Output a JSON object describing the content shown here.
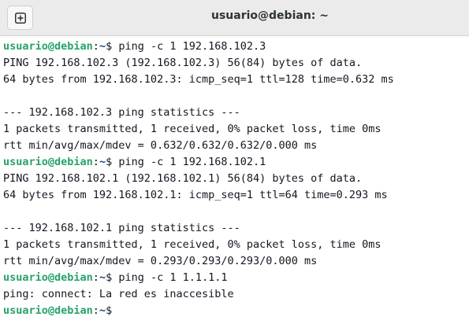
{
  "window": {
    "title": "usuario@debian: ~"
  },
  "icons": {
    "new_tab": "plus-square-icon"
  },
  "colors": {
    "prompt_user": "#26a269",
    "prompt_path": "#12488b",
    "text": "#171421",
    "titlebar": "#ebebeb"
  },
  "terminal": {
    "prompt_user_host": "usuario@debian",
    "prompt_path": "~",
    "lines": [
      {
        "kind": "cmd",
        "command": "ping -c 1 192.168.102.3"
      },
      {
        "kind": "out",
        "text": "PING 192.168.102.3 (192.168.102.3) 56(84) bytes of data."
      },
      {
        "kind": "out",
        "text": "64 bytes from 192.168.102.3: icmp_seq=1 ttl=128 time=0.632 ms"
      },
      {
        "kind": "out",
        "text": ""
      },
      {
        "kind": "out",
        "text": "--- 192.168.102.3 ping statistics ---"
      },
      {
        "kind": "out",
        "text": "1 packets transmitted, 1 received, 0% packet loss, time 0ms"
      },
      {
        "kind": "out",
        "text": "rtt min/avg/max/mdev = 0.632/0.632/0.632/0.000 ms"
      },
      {
        "kind": "cmd",
        "command": "ping -c 1 192.168.102.1"
      },
      {
        "kind": "out",
        "text": "PING 192.168.102.1 (192.168.102.1) 56(84) bytes of data."
      },
      {
        "kind": "out",
        "text": "64 bytes from 192.168.102.1: icmp_seq=1 ttl=64 time=0.293 ms"
      },
      {
        "kind": "out",
        "text": ""
      },
      {
        "kind": "out",
        "text": "--- 192.168.102.1 ping statistics ---"
      },
      {
        "kind": "out",
        "text": "1 packets transmitted, 1 received, 0% packet loss, time 0ms"
      },
      {
        "kind": "out",
        "text": "rtt min/avg/max/mdev = 0.293/0.293/0.293/0.000 ms"
      },
      {
        "kind": "cmd",
        "command": "ping -c 1 1.1.1.1"
      },
      {
        "kind": "out",
        "text": "ping: connect: La red es inaccesible"
      },
      {
        "kind": "cmd",
        "command": ""
      }
    ]
  }
}
